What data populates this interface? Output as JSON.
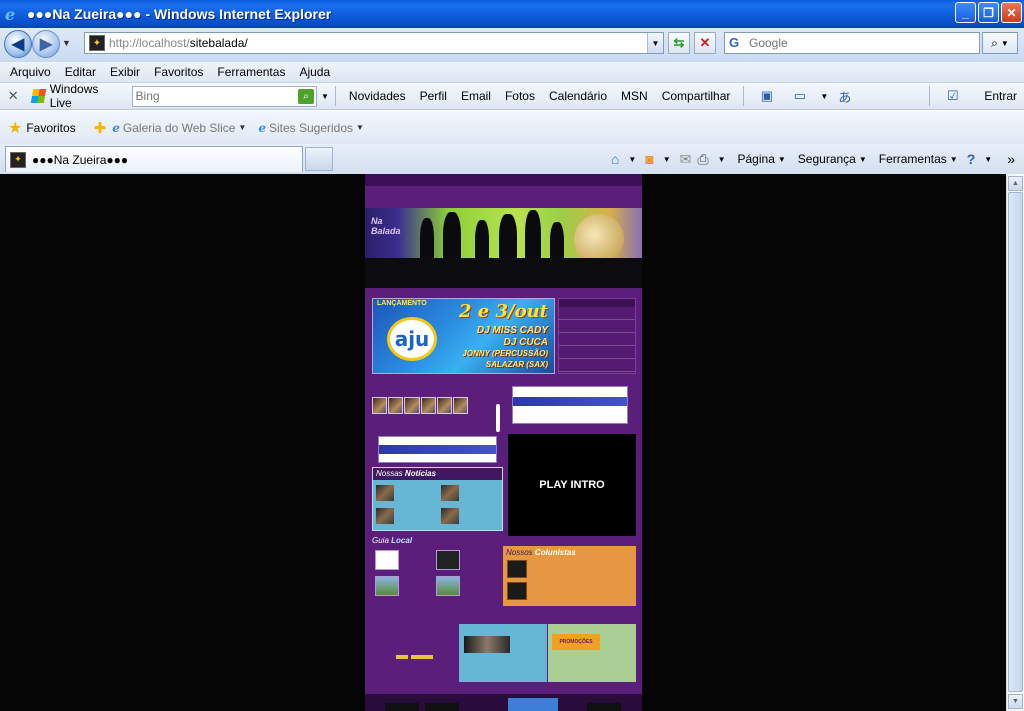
{
  "window": {
    "title": "●●●Na Zueira●●● - Windows Internet Explorer",
    "minimize": "_",
    "restore": "❐",
    "close": "✕"
  },
  "address": {
    "url_prefix": "http://localhost/",
    "url_path": "sitebalada/",
    "search_placeholder": "Google"
  },
  "menu": [
    "Arquivo",
    "Editar",
    "Exibir",
    "Favoritos",
    "Ferramentas",
    "Ajuda"
  ],
  "live_toolbar": {
    "brand": "Windows Live",
    "search_placeholder": "Bing",
    "items": [
      "Novidades",
      "Perfil",
      "Email",
      "Fotos",
      "Calendário",
      "MSN",
      "Compartilhar"
    ],
    "signin": "Entrar"
  },
  "favorites_bar": {
    "favorites_label": "Favoritos",
    "links": [
      "Galeria do Web Slice",
      "Sites Sugeridos"
    ]
  },
  "tab": {
    "title": "●●●Na Zueira●●●"
  },
  "command_bar": {
    "items": [
      "Página",
      "Segurança",
      "Ferramentas"
    ]
  },
  "site": {
    "play_intro": "PLAY INTRO",
    "ad_dates": "2 e 3/out",
    "ad_launch": "LANÇAMENTO",
    "ad_brand": "aju",
    "ad_lines": [
      "DJ MISS CADY",
      "DJ CUCA",
      "JONNY (PERCUSSÃO)",
      "SALAZAR (SAX)"
    ],
    "noticias_heading_1": "Nossas",
    "noticias_heading_2": "Notícias",
    "guia_heading_1": "Guia",
    "guia_heading_2": "Local",
    "colunistas_heading_1": "Nossos",
    "colunistas_heading_2": "Colunistas",
    "promo_label": "PROMOÇÕES"
  }
}
